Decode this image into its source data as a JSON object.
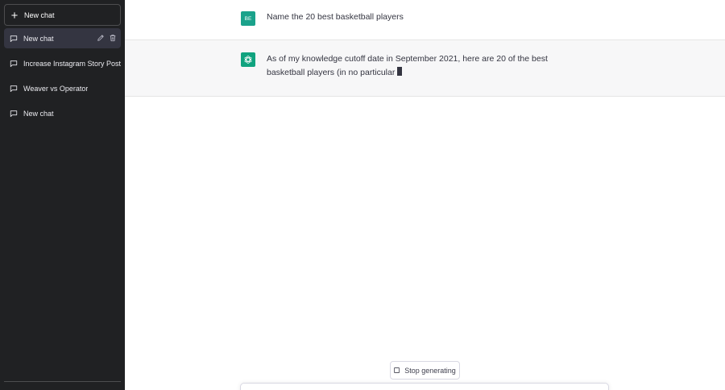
{
  "sidebar": {
    "new_chat_label": "New chat",
    "items": [
      {
        "label": "New chat",
        "active": true
      },
      {
        "label": "Increase Instagram Story Post"
      },
      {
        "label": "Weaver vs Operator"
      },
      {
        "label": "New chat"
      }
    ]
  },
  "conversation": {
    "user_avatar": "BE",
    "user_message": "Name the 20 best basketball players",
    "assistant_message": "As of my knowledge cutoff date in September 2021, here are 20 of the best basketball players (in no particular"
  },
  "controls": {
    "stop_label": "Stop generating"
  },
  "colors": {
    "sidebar_bg": "#202123",
    "assistant_bg": "#f7f7f8",
    "accent": "#10a37f"
  },
  "icons": {
    "new_chat": "plus-icon",
    "history": "chat-bubble-icon",
    "edit": "pencil-icon",
    "delete": "trash-icon",
    "assistant": "openai-logo-icon",
    "stop": "stop-square-icon"
  }
}
